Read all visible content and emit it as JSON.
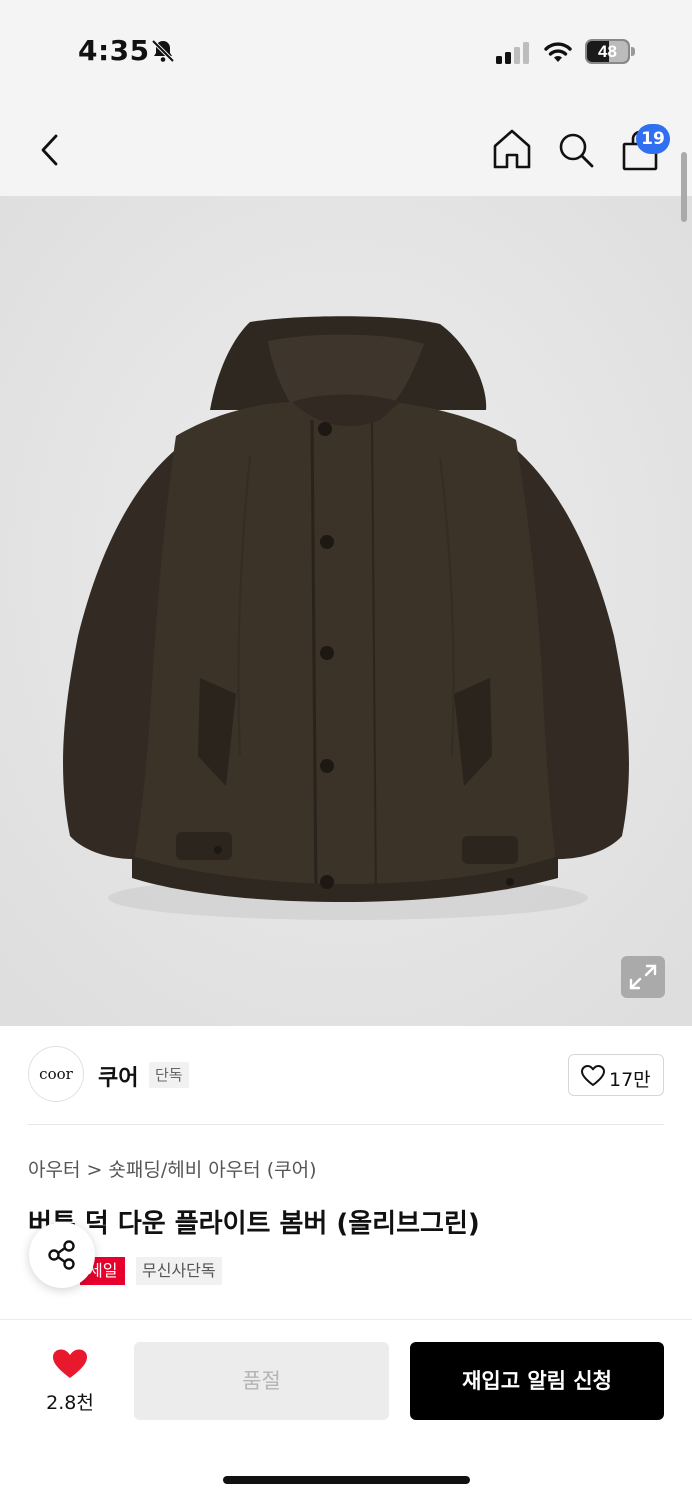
{
  "status_bar": {
    "time": "4:35",
    "battery": "48",
    "icons": [
      "bell-slash-icon",
      "signal-icon",
      "wifi-icon",
      "battery-icon"
    ]
  },
  "nav": {
    "icons": [
      "back-chevron-icon",
      "home-icon",
      "search-icon",
      "shopping-bag-icon"
    ],
    "cart_count": "19"
  },
  "hero": {
    "image": "dark olive down bomber jacket with hood",
    "expand_icon": "expand-arrows-icon"
  },
  "brand": {
    "logo_text": "coor",
    "name": "쿠어",
    "tag": "단독",
    "likes": "17만"
  },
  "breadcrumb": {
    "level1": "아우터",
    "separator": ">",
    "level2": "숏패딩/헤비 아우터 (쿠어)"
  },
  "product": {
    "title": "버튼 덕 다운 플라이트 봄버 (올리브그린)",
    "tags": [
      "세일",
      "무신사단독"
    ]
  },
  "bottom": {
    "wish_count": "2.8천",
    "soldout_label": "품절",
    "restock_label": "재입고 알림 신청"
  },
  "colors": {
    "accent_blue": "#2f6ff0",
    "sale_red": "#e8002d",
    "heart_red": "#e8192c",
    "jacket": "#3b3228"
  }
}
